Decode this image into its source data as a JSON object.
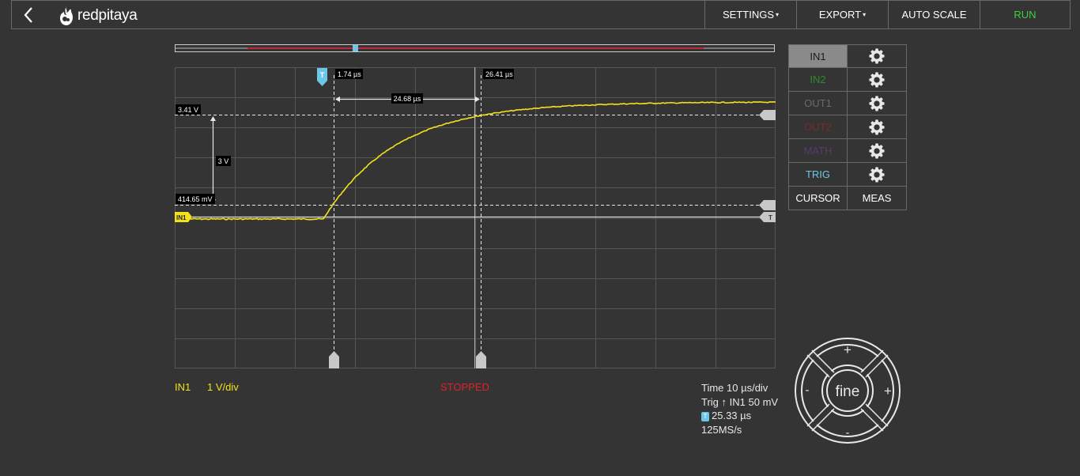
{
  "header": {
    "logo_text": "redpitaya",
    "settings_label": "SETTINGS",
    "export_label": "EXPORT",
    "autoscale_label": "AUTO SCALE",
    "run_label": "RUN",
    "run_color": "#3fcf3f"
  },
  "panel": {
    "rows": [
      {
        "label": "IN1",
        "color": "#1a1a1a",
        "active": true
      },
      {
        "label": "IN2",
        "color": "#2e8b2e"
      },
      {
        "label": "OUT1",
        "color": "#6a6a6a"
      },
      {
        "label": "OUT2",
        "color": "#7a2a2a"
      },
      {
        "label": "MATH",
        "color": "#5a3a6a"
      },
      {
        "label": "TRIG",
        "color": "#6cc6e6"
      }
    ],
    "cursor_label": "CURSOR",
    "meas_label": "MEAS"
  },
  "scope": {
    "trigger_marker": "T",
    "cursor_x1_label": "1.74 µs",
    "cursor_x2_label": "26.41 µs",
    "delta_x_label": "24.68 µs",
    "cursor_y1_label": "3.41 V",
    "cursor_y2_label": "414.65 mV",
    "delta_y_label": "3 V",
    "channel_marker": "IN1",
    "trigger_level_marker": "T",
    "trace_color": "#f2e21b"
  },
  "status": {
    "channel": "IN1",
    "scale": "1 V/div",
    "state": "STOPPED"
  },
  "info": {
    "time": "Time 10 µs/div",
    "trig": "Trig",
    "trig_arrow": "↑",
    "trig_source": "IN1 50 mV",
    "trig_badge": "T",
    "trig_delay": "25.33 µs",
    "sample_rate": "125MS/s"
  },
  "dpad": {
    "center_label": "fine",
    "plus_label": "+",
    "minus_label": "-"
  }
}
